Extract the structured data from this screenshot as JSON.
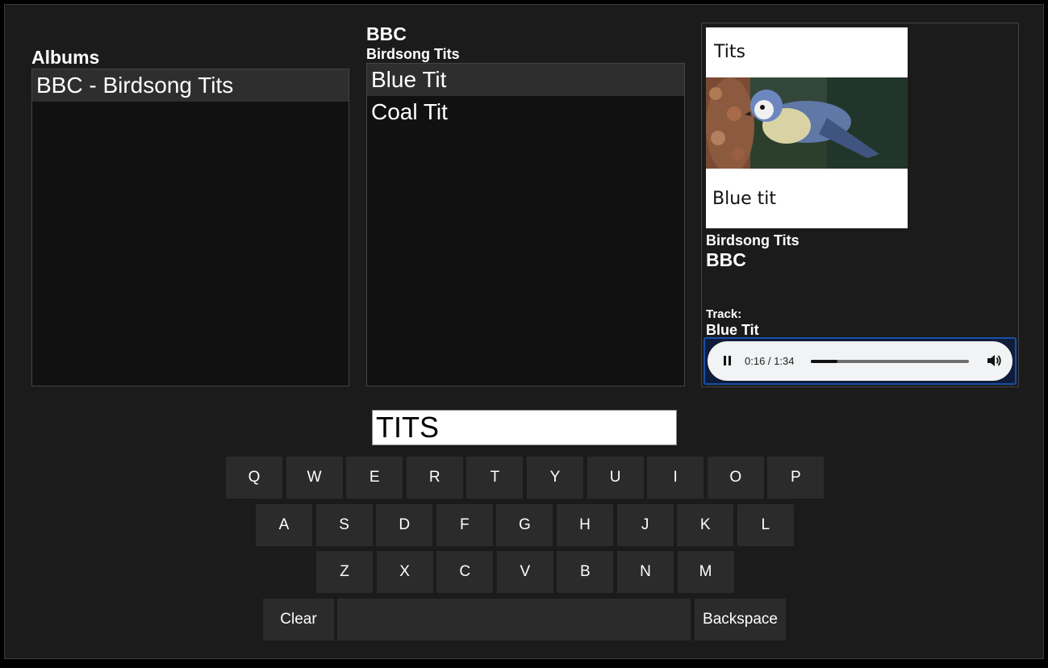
{
  "albums": {
    "heading": "Albums",
    "items": [
      "BBC - Birdsong Tits"
    ]
  },
  "tracks": {
    "artist": "BBC",
    "album": "Birdsong Tits",
    "items": [
      "Blue Tit",
      "Coal Tit"
    ]
  },
  "now_playing": {
    "cover_top_text": "Tits",
    "cover_bottom_text": "Blue tit",
    "album": "Birdsong Tits",
    "artist": "BBC",
    "track_label": "Track:",
    "track": "Blue Tit",
    "time": "0:16 / 1:34",
    "progress_fraction": 0.17
  },
  "search": {
    "value": "TITS"
  },
  "keyboard": {
    "row1": [
      "Q",
      "W",
      "E",
      "R",
      "T",
      "Y",
      "U",
      "I",
      "O",
      "P"
    ],
    "row2": [
      "A",
      "S",
      "D",
      "F",
      "G",
      "H",
      "J",
      "K",
      "L"
    ],
    "row3": [
      "Z",
      "X",
      "C",
      "V",
      "B",
      "N",
      "M"
    ],
    "clear": "Clear",
    "space": "",
    "backspace": "Backspace"
  },
  "colors": {
    "background": "#1b1b1b",
    "panel": "#111111",
    "selected": "#2e2e2e",
    "key": "#2b2b2b",
    "focus_ring": "#1a4fa8"
  }
}
